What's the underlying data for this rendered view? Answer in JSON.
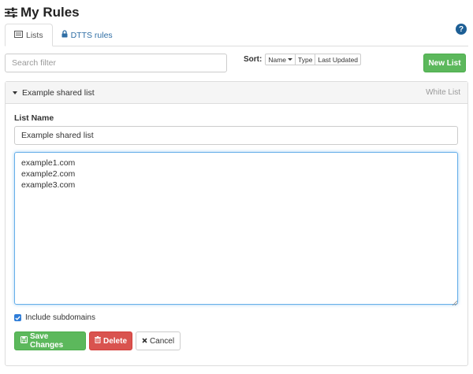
{
  "header": {
    "title": "My Rules",
    "title_icon": "sliders-icon",
    "help_icon": "question-circle-icon"
  },
  "tabs": [
    {
      "label": "Lists",
      "icon": "list-icon",
      "active": true
    },
    {
      "label": "DTTS rules",
      "icon": "lock-icon",
      "active": false
    }
  ],
  "search": {
    "placeholder": "Search filter",
    "value": ""
  },
  "sort": {
    "label": "Sort:",
    "options": [
      "Name",
      "Type",
      "Last Updated"
    ],
    "selected": "Name"
  },
  "new_list_button": "New List",
  "list": {
    "name": "Example shared list",
    "type": "White List",
    "expanded": true,
    "name_label": "List Name",
    "name_value": "Example shared list",
    "domains": "example1.com\nexample2.com\nexample3.com",
    "include_subdomains": {
      "label": "Include subdomains",
      "checked": true
    }
  },
  "actions": {
    "save": "Save Changes",
    "delete": "Delete",
    "cancel": "Cancel"
  },
  "colors": {
    "success": "#5cb85c",
    "danger": "#d9534f",
    "link": "#2f6ea5",
    "focus": "#66afe9",
    "help": "#1d5f95"
  }
}
